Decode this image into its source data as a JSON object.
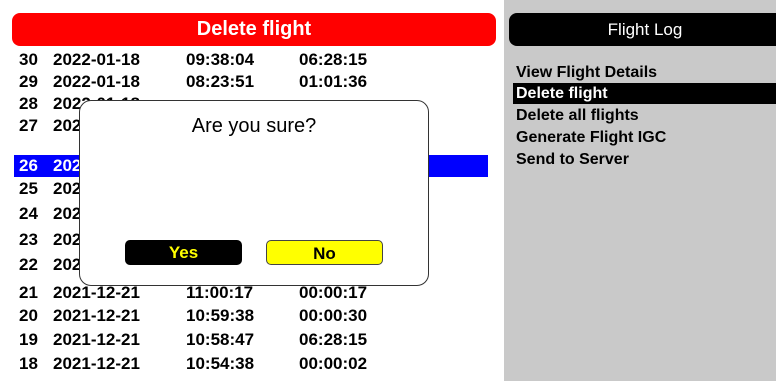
{
  "left_panel": {
    "title": "Delete flight",
    "rows": [
      {
        "num": "30",
        "date": "2022-01-18",
        "time": "09:38:04",
        "duration": "06:28:15",
        "selected": false
      },
      {
        "num": "29",
        "date": "2022-01-18",
        "time": "08:23:51",
        "duration": "01:01:36",
        "selected": false
      },
      {
        "num": "28",
        "date": "2022-01-18",
        "time": "",
        "duration": "",
        "selected": false
      },
      {
        "num": "27",
        "date": "2022-01-18",
        "time": "",
        "duration": "",
        "selected": false
      },
      {
        "num": "26",
        "date": "2022-01-18",
        "time": "",
        "duration": "",
        "selected": true
      },
      {
        "num": "25",
        "date": "2022-01-18",
        "time": "",
        "duration": "",
        "selected": false
      },
      {
        "num": "24",
        "date": "2022-01-18",
        "time": "",
        "duration": "",
        "selected": false
      },
      {
        "num": "23",
        "date": "2022-01-18",
        "time": "",
        "duration": "",
        "selected": false
      },
      {
        "num": "22",
        "date": "2022-01-18",
        "time": "",
        "duration": "",
        "selected": false
      },
      {
        "num": "21",
        "date": "2021-12-21",
        "time": "11:00:17",
        "duration": "00:00:17",
        "selected": false
      },
      {
        "num": "20",
        "date": "2021-12-21",
        "time": "10:59:38",
        "duration": "00:00:30",
        "selected": false
      },
      {
        "num": "19",
        "date": "2021-12-21",
        "time": "10:58:47",
        "duration": "06:28:15",
        "selected": false
      },
      {
        "num": "18",
        "date": "2021-12-21",
        "time": "10:54:38",
        "duration": "00:00:02",
        "selected": false
      }
    ]
  },
  "right_panel": {
    "title": "Flight Log",
    "menu": [
      {
        "label": "View Flight Details",
        "active": false
      },
      {
        "label": "Delete flight",
        "active": true
      },
      {
        "label": "Delete all flights",
        "active": false
      },
      {
        "label": "Generate Flight IGC",
        "active": false
      },
      {
        "label": "Send to Server",
        "active": false
      }
    ]
  },
  "dialog": {
    "title": "Are you sure?",
    "yes_label": "Yes",
    "no_label": "No"
  },
  "colors": {
    "header_red": "#ff0000",
    "selection_blue": "#0000ff",
    "side_gray": "#c9c9c9",
    "button_yellow": "#ffff00"
  }
}
